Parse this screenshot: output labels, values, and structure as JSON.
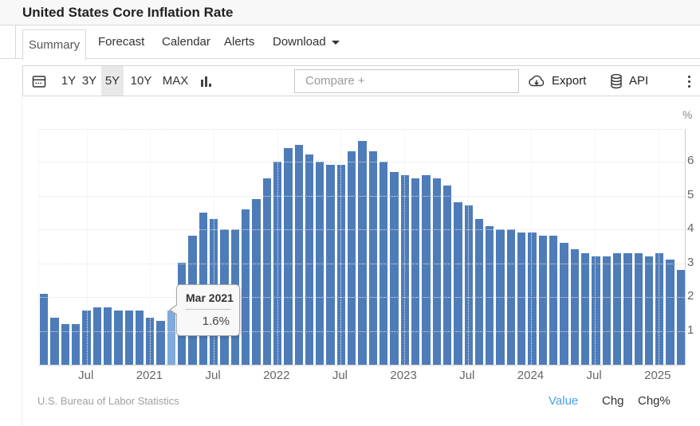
{
  "title": "United States Core Inflation Rate",
  "tabs": {
    "summary": "Summary",
    "forecast": "Forecast",
    "calendar": "Calendar",
    "alerts": "Alerts",
    "download": "Download",
    "active_tab": "Summary"
  },
  "toolbar": {
    "ranges": [
      "1Y",
      "3Y",
      "5Y",
      "10Y",
      "MAX"
    ],
    "selected_range": "5Y",
    "compare_placeholder": "Compare +",
    "export_label": "Export",
    "api_label": "API",
    "icons": [
      "calendar-icon",
      "column-chart-icon",
      "cloud-download-icon",
      "database-icon",
      "kebab-menu-icon"
    ]
  },
  "tooltip": {
    "title": "Mar 2021",
    "value": "1.6%"
  },
  "footer": {
    "source": "U.S. Bureau of Labor Statistics",
    "links": [
      {
        "label": "Value",
        "active": true
      },
      {
        "label": "Chg",
        "active": false
      },
      {
        "label": "Chg%",
        "active": false
      }
    ]
  },
  "chart_data": {
    "type": "bar",
    "title": "United States Core Inflation Rate",
    "ylabel": "%",
    "xlabel": "",
    "ylim": [
      0,
      7
    ],
    "grid": true,
    "bar_color": "#4e7cb9",
    "highlight_color": "#82aada",
    "highlight_index": 12,
    "y_ticks": [
      1,
      2,
      3,
      4,
      5,
      6
    ],
    "x_ticks": [
      {
        "label": "Jul",
        "month_index": 4
      },
      {
        "label": "2021",
        "month_index": 10
      },
      {
        "label": "Jul",
        "month_index": 16
      },
      {
        "label": "2022",
        "month_index": 22
      },
      {
        "label": "Jul",
        "month_index": 28
      },
      {
        "label": "2023",
        "month_index": 34
      },
      {
        "label": "Jul",
        "month_index": 40
      },
      {
        "label": "2024",
        "month_index": 46
      },
      {
        "label": "Jul",
        "month_index": 52
      },
      {
        "label": "2025",
        "month_index": 58
      }
    ],
    "categories": [
      "Mar 2020",
      "Apr 2020",
      "May 2020",
      "Jun 2020",
      "Jul 2020",
      "Aug 2020",
      "Sep 2020",
      "Oct 2020",
      "Nov 2020",
      "Dec 2020",
      "Jan 2021",
      "Feb 2021",
      "Mar 2021",
      "Apr 2021",
      "May 2021",
      "Jun 2021",
      "Jul 2021",
      "Aug 2021",
      "Sep 2021",
      "Oct 2021",
      "Nov 2021",
      "Dec 2021",
      "Jan 2022",
      "Feb 2022",
      "Mar 2022",
      "Apr 2022",
      "May 2022",
      "Jun 2022",
      "Jul 2022",
      "Aug 2022",
      "Sep 2022",
      "Oct 2022",
      "Nov 2022",
      "Dec 2022",
      "Jan 2023",
      "Feb 2023",
      "Mar 2023",
      "Apr 2023",
      "May 2023",
      "Jun 2023",
      "Jul 2023",
      "Aug 2023",
      "Sep 2023",
      "Oct 2023",
      "Nov 2023",
      "Dec 2023",
      "Jan 2024",
      "Feb 2024",
      "Mar 2024",
      "Apr 2024",
      "May 2024",
      "Jun 2024",
      "Jul 2024",
      "Aug 2024",
      "Sep 2024",
      "Oct 2024",
      "Nov 2024",
      "Dec 2024",
      "Jan 2025",
      "Feb 2025",
      "Mar 2025"
    ],
    "values": [
      2.1,
      1.4,
      1.2,
      1.2,
      1.6,
      1.7,
      1.7,
      1.6,
      1.6,
      1.6,
      1.4,
      1.3,
      1.6,
      3.0,
      3.8,
      4.5,
      4.3,
      4.0,
      4.0,
      4.6,
      4.9,
      5.5,
      6.0,
      6.4,
      6.5,
      6.2,
      6.0,
      5.9,
      5.9,
      6.3,
      6.6,
      6.3,
      6.0,
      5.7,
      5.6,
      5.5,
      5.6,
      5.5,
      5.3,
      4.8,
      4.7,
      4.3,
      4.1,
      4.0,
      4.0,
      3.9,
      3.9,
      3.8,
      3.8,
      3.6,
      3.4,
      3.3,
      3.2,
      3.2,
      3.3,
      3.3,
      3.3,
      3.2,
      3.3,
      3.1,
      2.8
    ]
  }
}
